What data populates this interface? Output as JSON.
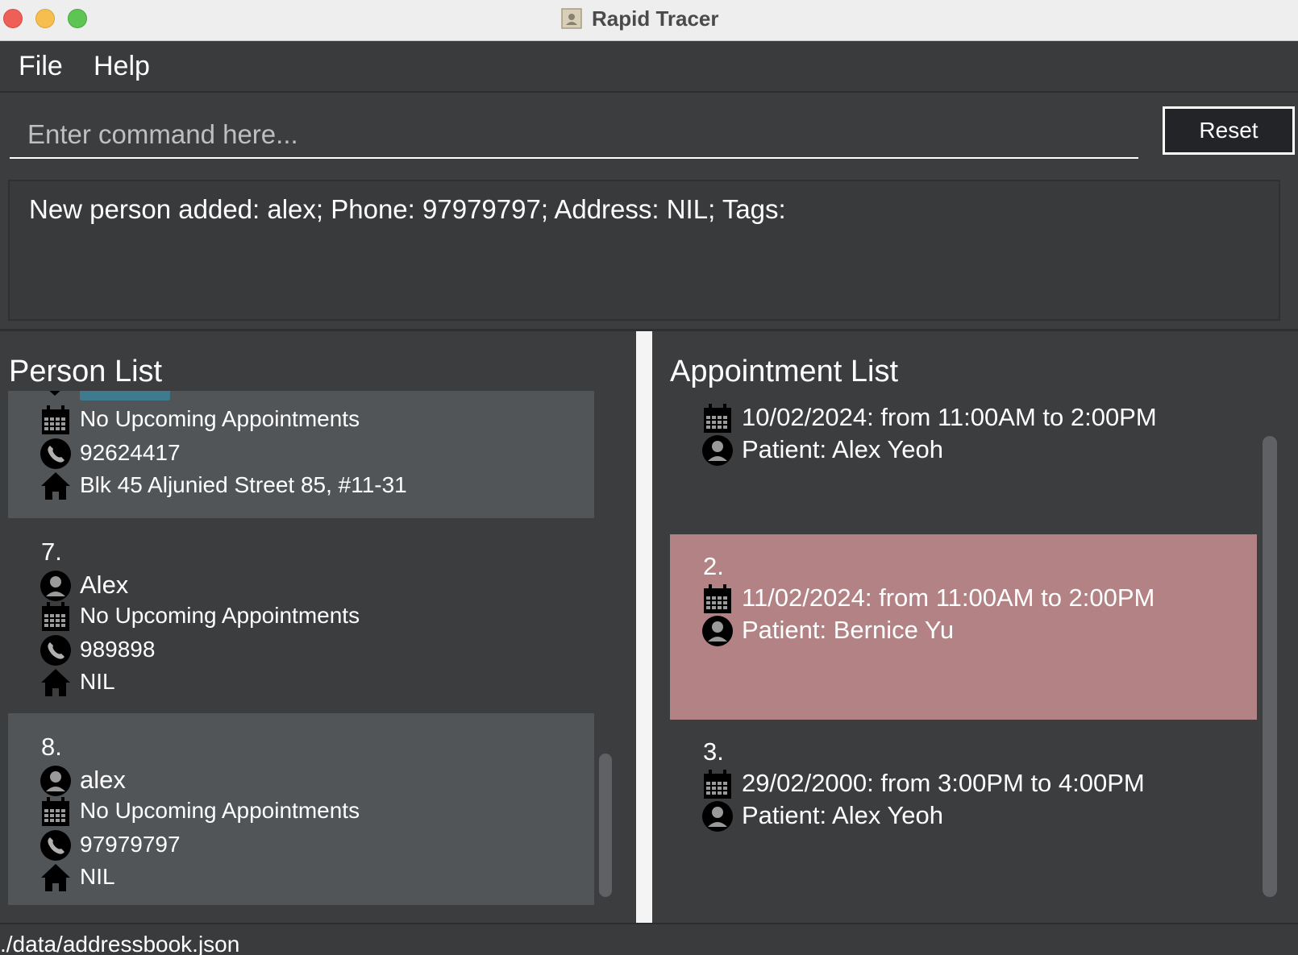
{
  "window": {
    "title": "Rapid Tracer"
  },
  "menu": {
    "file": "File",
    "help": "Help"
  },
  "command": {
    "placeholder": "Enter command here...",
    "reset_label": "Reset"
  },
  "result": {
    "text": "New person added: alex; Phone: 97979797; Address: NIL; Tags:"
  },
  "person_list": {
    "title": "Person List",
    "partial_card": {
      "appointment": "No Upcoming Appointments",
      "phone": "92624417",
      "address": "Blk 45 Aljunied Street 85, #11-31"
    },
    "cards": [
      {
        "index": "7.",
        "name": "Alex",
        "appointment": "No Upcoming Appointments",
        "phone": "989898",
        "address": "NIL"
      },
      {
        "index": "8.",
        "name": "alex",
        "appointment": "No Upcoming Appointments",
        "phone": "97979797",
        "address": "NIL"
      }
    ]
  },
  "appointment_list": {
    "title": "Appointment List",
    "cards": [
      {
        "index": "",
        "time": "10/02/2024: from 11:00AM to 2:00PM",
        "patient": "Patient: Alex Yeoh"
      },
      {
        "index": "2.",
        "time": "11/02/2024: from 11:00AM to 2:00PM",
        "patient": "Patient: Bernice Yu"
      },
      {
        "index": "3.",
        "time": "29/02/2000: from 3:00PM to 4:00PM",
        "patient": "Patient: Alex Yeoh"
      }
    ]
  },
  "status": {
    "path": "./data/addressbook.json"
  },
  "colors": {
    "selected_card": "#b38285",
    "alt_card": "#515558",
    "background": "#3c3d3f",
    "tag": "#3e7b91"
  }
}
